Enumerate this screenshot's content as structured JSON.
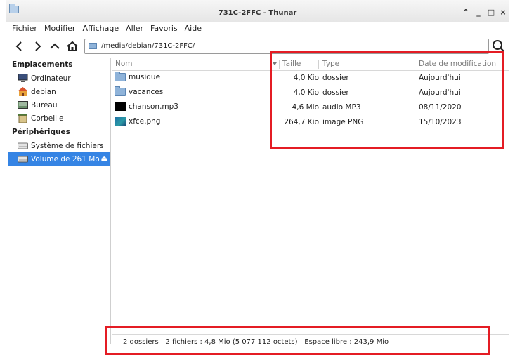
{
  "window": {
    "title": "731C-2FFC - Thunar"
  },
  "titlebar_controls": {
    "up": "^",
    "minimize": "_",
    "maximize": "□",
    "close": "×"
  },
  "menubar": {
    "items": [
      "Fichier",
      "Modifier",
      "Affichage",
      "Aller",
      "Favoris",
      "Aide"
    ]
  },
  "toolbar": {
    "path": "/media/debian/731C-2FFC/"
  },
  "sidebar": {
    "places_heading": "Emplacements",
    "places": [
      {
        "label": "Ordinateur",
        "icon": "computer-icon"
      },
      {
        "label": "debian",
        "icon": "home-icon"
      },
      {
        "label": "Bureau",
        "icon": "desktop-icon"
      },
      {
        "label": "Corbeille",
        "icon": "trash-icon"
      }
    ],
    "devices_heading": "Périphériques",
    "devices": [
      {
        "label": "Système de fichiers",
        "icon": "drive-icon"
      },
      {
        "label": "Volume de 261 Mo",
        "icon": "drive-icon",
        "selected": true,
        "eject": "⏏"
      }
    ]
  },
  "columns": {
    "name": "Nom",
    "size": "Taille",
    "type": "Type",
    "date": "Date de modification"
  },
  "files": [
    {
      "name": "musique",
      "size": "4,0 Kio",
      "type": "dossier",
      "date": "Aujourd'hui",
      "icon": "folder-icon"
    },
    {
      "name": "vacances",
      "size": "4,0 Kio",
      "type": "dossier",
      "date": "Aujourd'hui",
      "icon": "folder-icon"
    },
    {
      "name": "chanson.mp3",
      "size": "4,6 Mio",
      "type": "audio MP3",
      "date": "08/11/2020",
      "icon": "audio-thumbnail-icon"
    },
    {
      "name": "xfce.png",
      "size": "264,7 Kio",
      "type": "image PNG",
      "date": "15/10/2023",
      "icon": "image-thumbnail-icon"
    }
  ],
  "statusbar": {
    "text": "2 dossiers  |  2 fichiers : 4,8 Mio (5 077 112 octets)  |  Espace libre : 243,9 Mio"
  },
  "colors": {
    "selection": "#3584e4",
    "annotation": "#e41c24"
  }
}
